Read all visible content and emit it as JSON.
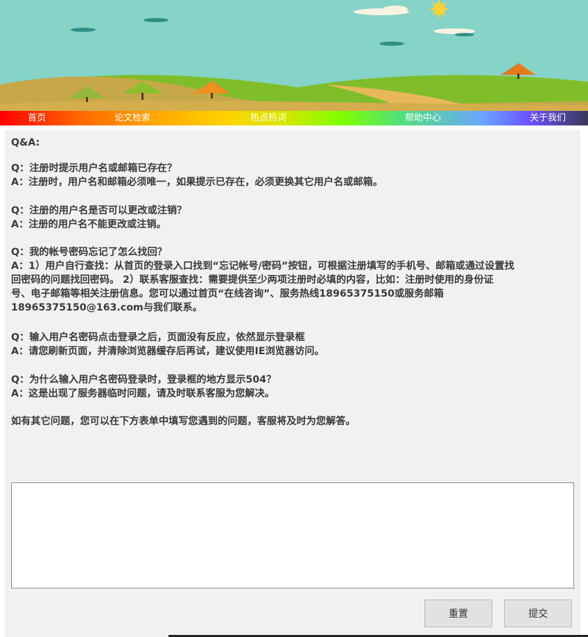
{
  "nav": {
    "items": [
      {
        "label": "首页"
      },
      {
        "label": "论文检索"
      },
      {
        "label": "热点热词"
      },
      {
        "label": "帮助中心"
      },
      {
        "label": "关于我们"
      }
    ]
  },
  "faq": {
    "heading": "Q&A:",
    "items": [
      {
        "q": "Q：注册时提示用户名或邮箱已存在？",
        "a": "A：注册时，用户名和邮箱必须唯一，如果提示已存在，必须更换其它用户名或邮箱。"
      },
      {
        "q": "Q：注册的用户名是否可以更改或注销？",
        "a": "A：注册的用户名不能更改或注销。"
      },
      {
        "q": "Q：我的帐号密码忘记了怎么找回？",
        "a_lines": [
          "A：1）用户自行查找：从首页的登录入口找到“忘记帐号/密码”按钮，可根据注册填写的手机号、邮箱或通过设置找",
          "回密码的问题找回密码。 2）联系客服查找：需要提供至少两项注册时必填的内容，比如：注册时使用的身份证",
          "号、电子邮箱等相关注册信息。您可以通过首页“在线咨询”、服务热线18965375150或服务邮箱",
          "18965375150@163.com与我们联系。"
        ]
      },
      {
        "q": "Q：输入用户名密码点击登录之后，页面没有反应，依然显示登录框",
        "a": "A：请您刷新页面，并清除浏览器缓存后再试，建议使用IE浏览器访问。"
      },
      {
        "q": "Q：为什么输入用户名密码登录时，登录框的地方显示504？",
        "a": "A：这是出现了服务器临时问题，请及时联系客服为您解决。"
      }
    ],
    "footer_note": "如有其它问题，您可以在下方表单中填写您遇到的问题，客服将及时为您解答。"
  },
  "form": {
    "message_value": "",
    "reset_label": "重置",
    "submit_label": "提交"
  },
  "colors": {
    "sky": "#86d3c7",
    "panel_bg": "#f1f1f1",
    "text": "#3a3a3a",
    "button_bg": "#e2e2e2"
  }
}
